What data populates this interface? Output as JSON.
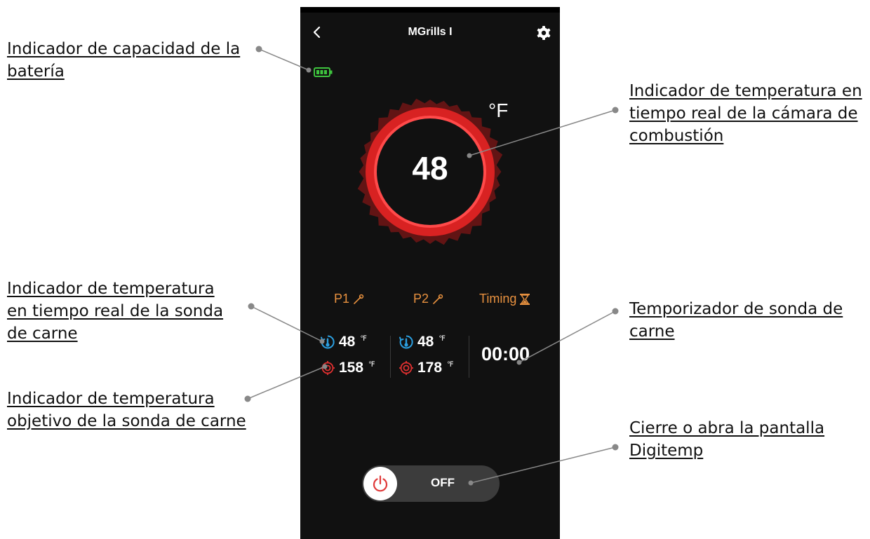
{
  "app": {
    "title": "MGrills I",
    "temp_unit": "°F"
  },
  "chamber": {
    "current_temp": "48"
  },
  "tabs": {
    "p1": "P1",
    "p2": "P2",
    "timing": "Timing"
  },
  "probes": [
    {
      "actual": "48",
      "target": "158",
      "unit": "℉"
    },
    {
      "actual": "48",
      "target": "178",
      "unit": "℉"
    }
  ],
  "timer": {
    "value": "00:00"
  },
  "power": {
    "state": "OFF"
  },
  "annotations": [
    {
      "lines": [
        "Indicador de capacidad de la",
        "batería"
      ]
    },
    {
      "lines": [
        "Indicador de temperatura en",
        "tiempo real de la cámara de",
        "combustión"
      ]
    },
    {
      "lines": [
        "Indicador de temperatura",
        "en tiempo real de la sonda",
        "de carne"
      ]
    },
    {
      "lines": [
        "Temporizador de sonda de",
        "carne"
      ]
    },
    {
      "lines": [
        "Indicador de temperatura",
        "objetivo de la sonda de carne"
      ]
    },
    {
      "lines": [
        "Cierre o abra la pantalla",
        "Digitemp"
      ]
    }
  ],
  "colors": {
    "background": "#111111",
    "accent_orange": "#e8913f",
    "ring_red": "#e02020",
    "probe_blue": "#2b9fe0",
    "target_red": "#e03030",
    "battery_green": "#3ec43e"
  },
  "icons": {
    "back": "chevron-left-icon",
    "settings": "gear-icon",
    "battery": "battery-icon",
    "probe": "probe-icon",
    "timer": "hourglass-icon",
    "thermometer": "thermometer-icon",
    "target": "target-icon",
    "power": "power-icon"
  }
}
